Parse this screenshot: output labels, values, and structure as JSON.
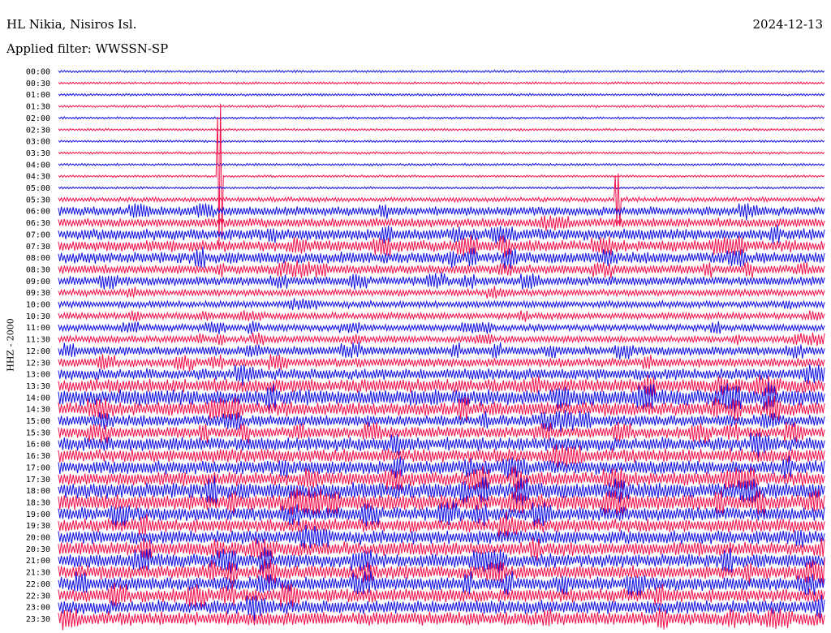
{
  "header": {
    "station": "HL Nikia, Nisiros Isl.",
    "date": "2024-12-13",
    "filter": "Applied filter: WWSSN-SP"
  },
  "chart_data": {
    "type": "seismogram",
    "ylabel": "HHZ - 2000",
    "rows": [
      "00:00",
      "00:30",
      "01:00",
      "01:30",
      "02:00",
      "02:30",
      "03:00",
      "03:30",
      "04:00",
      "04:30",
      "05:00",
      "05:30",
      "06:00",
      "06:30",
      "07:00",
      "07:30",
      "08:00",
      "08:30",
      "09:00",
      "09:30",
      "10:00",
      "10:30",
      "11:00",
      "11:30",
      "12:00",
      "12:30",
      "13:00",
      "13:30",
      "14:00",
      "14:30",
      "15:00",
      "15:30",
      "16:00",
      "16:30",
      "17:00",
      "17:30",
      "18:00",
      "18:30",
      "19:00",
      "19:30",
      "20:00",
      "20:30",
      "21:00",
      "21:30",
      "22:00",
      "22:30",
      "23:00",
      "23:30"
    ],
    "row_colors": [
      "#1010e0",
      "#f0104a"
    ],
    "amplitude_level": [
      1,
      1,
      1,
      1,
      1,
      1,
      1,
      1,
      1,
      1,
      1,
      2,
      4,
      4,
      5,
      5,
      5,
      4,
      4,
      3,
      3,
      3,
      3,
      3,
      4,
      4,
      5,
      6,
      7,
      6,
      5,
      5,
      6,
      6,
      6,
      6,
      7,
      7,
      6,
      6,
      6,
      6,
      6,
      6,
      6,
      6,
      6,
      6
    ],
    "events": [
      {
        "row": "04:30",
        "time_fraction": 0.21,
        "amplitude": 6.5,
        "note": "spike"
      },
      {
        "row": "05:30",
        "time_fraction": 0.73,
        "amplitude": 2.5,
        "note": "burst"
      }
    ]
  }
}
